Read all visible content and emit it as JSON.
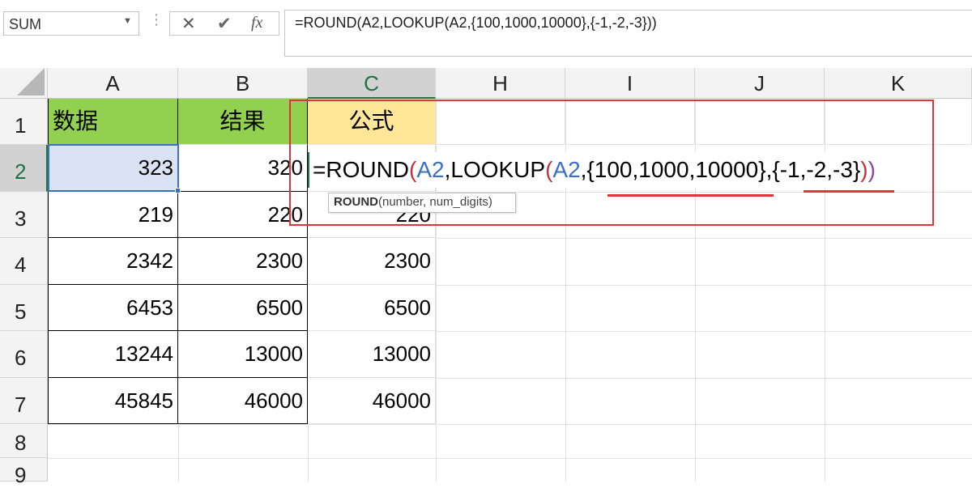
{
  "name_box": {
    "value": "SUM"
  },
  "formula_bar": {
    "cancel_glyph": "✕",
    "enter_glyph": "✔",
    "fx_label": "fx",
    "formula": "=ROUND(A2,LOOKUP(A2,{100,1000,10000},{-1,-2,-3}))"
  },
  "columns": [
    "A",
    "B",
    "C",
    "H",
    "I",
    "J",
    "K"
  ],
  "rows": [
    "1",
    "2",
    "3",
    "4",
    "5",
    "6",
    "7",
    "8",
    "9"
  ],
  "header_row": {
    "a": "数据",
    "b": "结果",
    "c": "公式"
  },
  "table": [
    {
      "a": "323",
      "b": "320",
      "c": ""
    },
    {
      "a": "219",
      "b": "220",
      "c": "220"
    },
    {
      "a": "2342",
      "b": "2300",
      "c": "2300"
    },
    {
      "a": "6453",
      "b": "6500",
      "c": "6500"
    },
    {
      "a": "13244",
      "b": "13000",
      "c": "13000"
    },
    {
      "a": "45845",
      "b": "46000",
      "c": "46000"
    }
  ],
  "cell_edit": {
    "p1": "=ROUND",
    "p2": "(",
    "p3": "A2",
    "p4": ",LOOKUP",
    "p5": "(",
    "p6": "A2",
    "p7": ",{100,1000,10000},{-1,-2,-3}",
    "p8": ")",
    "p9": ")"
  },
  "tooltip": {
    "func": "ROUND",
    "args": "(number, num_digits)"
  },
  "colors": {
    "header_green": "#92d050",
    "header_yellow": "#ffe699",
    "selected_cell": "#dae3f3",
    "highlight_red": "#e0343c",
    "excel_green": "#217346"
  },
  "icons": {
    "dropdown": "chevron-down-icon",
    "fx": "function-icon"
  }
}
